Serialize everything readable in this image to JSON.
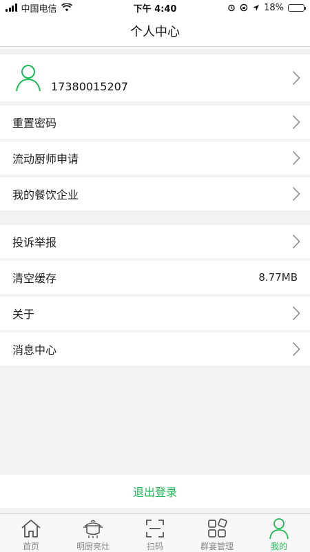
{
  "status_bar": {
    "carrier": "中国电信",
    "time": "下午 4:40",
    "battery": "18%",
    "battery_level": 0.18
  },
  "header": {
    "title": "个人中心"
  },
  "profile": {
    "phone": "17380015207"
  },
  "menu_group_1": [
    {
      "label": "重置密码"
    },
    {
      "label": "流动厨师申请"
    },
    {
      "label": "我的餐饮企业"
    }
  ],
  "menu_group_2": [
    {
      "label": "投诉举报"
    },
    {
      "label": "清空缓存",
      "value": "8.77MB"
    },
    {
      "label": "关于"
    },
    {
      "label": "消息中心"
    }
  ],
  "logout_label": "退出登录",
  "tabs": [
    {
      "label": "首页",
      "icon": "home-icon"
    },
    {
      "label": "明厨亮灶",
      "icon": "pot-icon"
    },
    {
      "label": "扫码",
      "icon": "scan-icon"
    },
    {
      "label": "群宴管理",
      "icon": "grid-icon"
    },
    {
      "label": "我的",
      "icon": "user-icon",
      "active": true
    }
  ],
  "colors": {
    "accent": "#1db954",
    "background": "#f2f2f2",
    "battery_low": "#e53935"
  }
}
